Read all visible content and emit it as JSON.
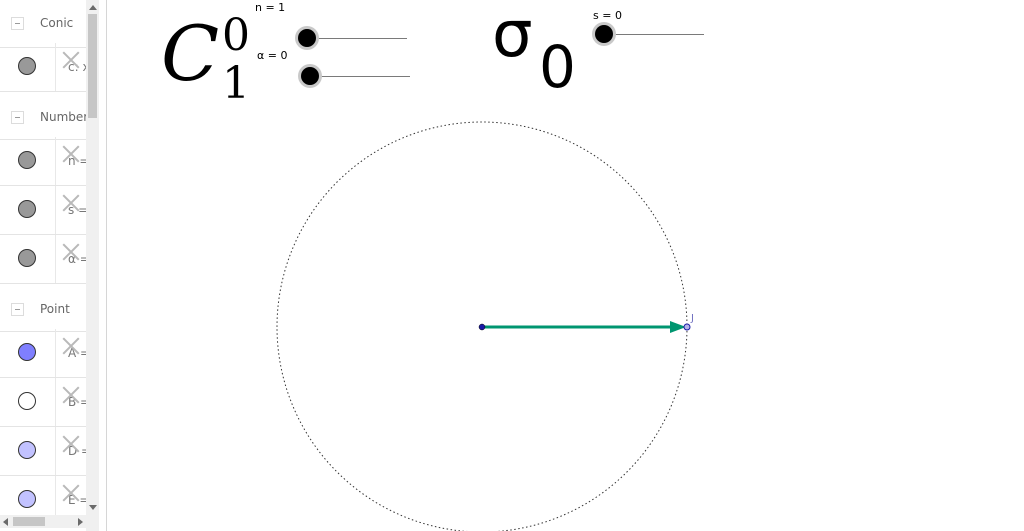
{
  "algebra": {
    "categories": {
      "conic": "Conic",
      "number": "Number",
      "point": "Point"
    },
    "items": {
      "conic_c": {
        "text": "c: x",
        "color": "#999999"
      },
      "number_n": {
        "text": "n =",
        "color": "#999999"
      },
      "number_s": {
        "text": "s =",
        "color": "#999999"
      },
      "number_alpha": {
        "text": "α =",
        "color": "#999999"
      },
      "point_A": {
        "text": "A =",
        "color": "#7f7fff"
      },
      "point_B": {
        "text": "B =",
        "color": "#ffffff"
      },
      "point_D": {
        "text": "D =",
        "color": "#c2c2ff"
      },
      "point_E": {
        "text": "E =",
        "color": "#c2c2ff"
      }
    }
  },
  "graphics": {
    "formula_left": {
      "base": "C",
      "sup": "0",
      "sub": "1"
    },
    "formula_right": {
      "base": "σ",
      "sub": "0"
    },
    "sliders": {
      "n": {
        "caption": "n = 1",
        "value": 1
      },
      "alpha": {
        "caption": "α = 0",
        "value": 0
      },
      "s": {
        "caption": "s = 0",
        "value": 0
      }
    },
    "point_label": "J",
    "colors": {
      "vector": "#009670",
      "center_point": "#1a1aa6",
      "point_J": "#7070c0",
      "circle": "#333333"
    }
  }
}
